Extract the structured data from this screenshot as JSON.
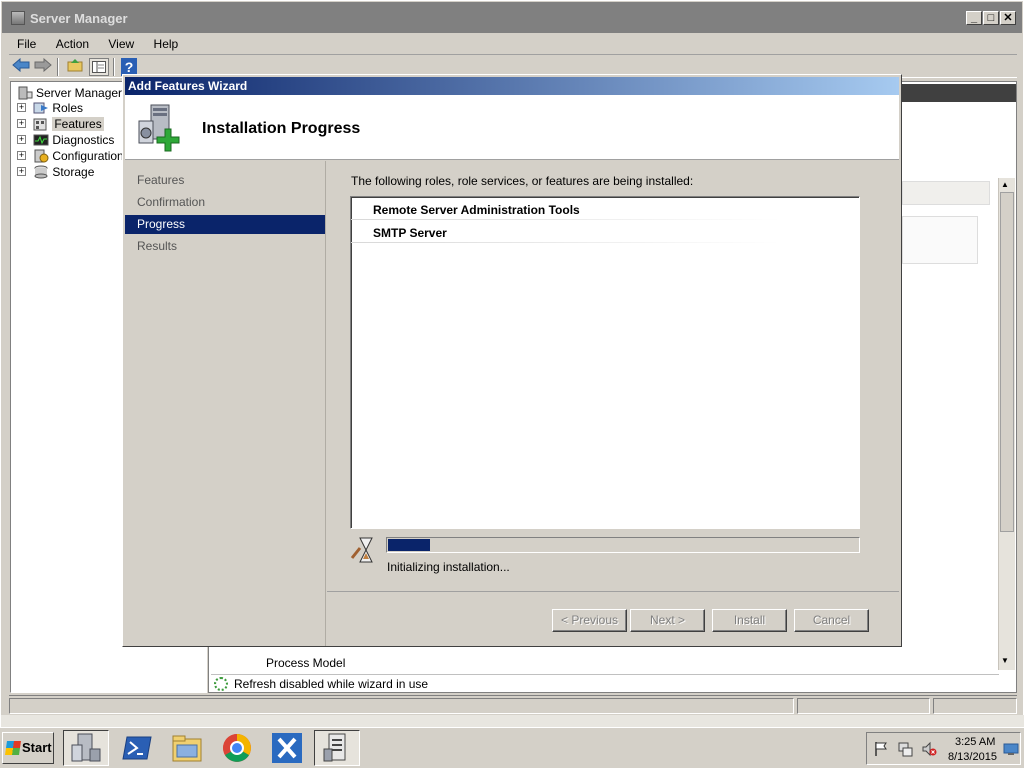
{
  "window": {
    "title": "Server Manager"
  },
  "window_buttons": {
    "minimize": "_",
    "maximize": "□",
    "close": "✕"
  },
  "menu": [
    "File",
    "Action",
    "View",
    "Help"
  ],
  "toolbar": {
    "back_icon": "back-arrow-icon",
    "forward_icon": "forward-arrow-icon",
    "help": "?"
  },
  "tree": {
    "root": "Server Manager (T",
    "items": [
      {
        "label": "Roles",
        "icon": "roles-icon"
      },
      {
        "label": "Features",
        "icon": "features-icon",
        "selected": true
      },
      {
        "label": "Diagnostics",
        "icon": "diagnostics-icon"
      },
      {
        "label": "Configuration",
        "icon": "configuration-icon"
      },
      {
        "label": "Storage",
        "icon": "storage-icon"
      }
    ],
    "expander": "+"
  },
  "right_pane": {
    "process_model": "Process Model",
    "refresh_status": "Refresh disabled while wizard in use"
  },
  "wizard": {
    "title": "Add Features Wizard",
    "header_title": "Installation Progress",
    "nav": [
      "Features",
      "Confirmation",
      "Progress",
      "Results"
    ],
    "active_step": "Progress",
    "intro": "The following roles, role services, or features are being installed:",
    "items": [
      "Remote Server Administration Tools",
      "SMTP Server"
    ],
    "progress": {
      "fraction": 0.09,
      "text": "Initializing installation..."
    },
    "buttons": {
      "previous": "< Previous",
      "next": "Next >",
      "install": "Install",
      "cancel": "Cancel"
    }
  },
  "taskbar": {
    "start": "Start",
    "apps": [
      "server-manager-icon",
      "powershell-icon",
      "explorer-icon",
      "chrome-icon",
      "tools-icon",
      "wizard-icon"
    ],
    "clock_time": "3:25 AM",
    "clock_date": "8/13/2015"
  },
  "colors": {
    "selection": "#0a246a",
    "title_gradient_end": "#a6caf0"
  }
}
